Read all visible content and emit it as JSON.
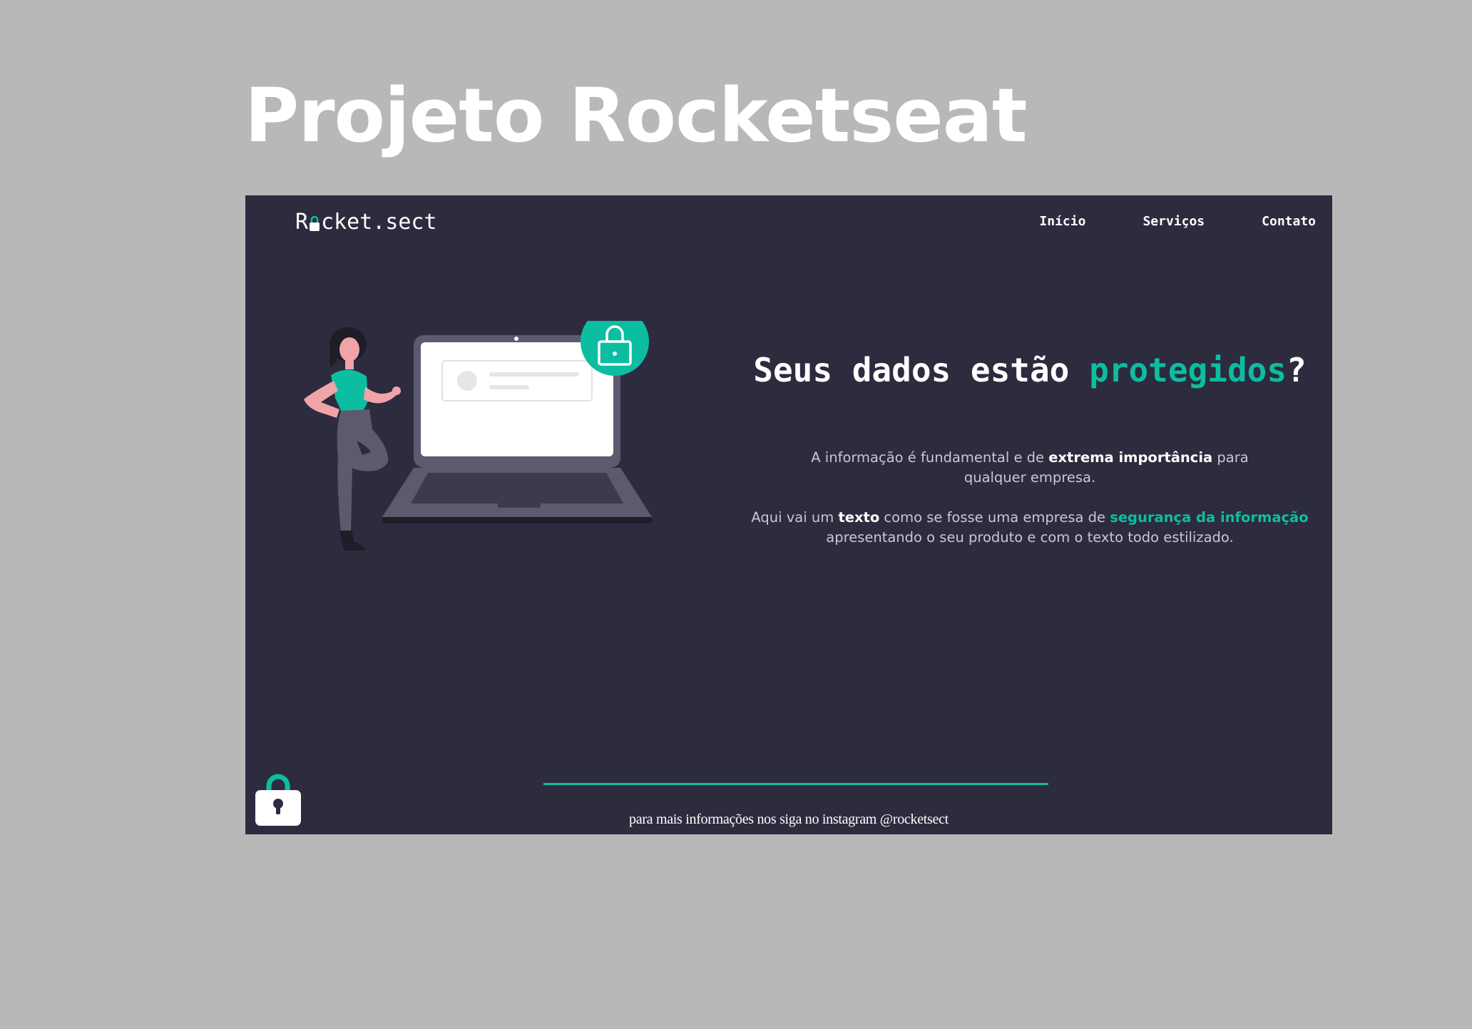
{
  "page": {
    "title": "Projeto Rocketseat"
  },
  "header": {
    "logo_prefix": "R",
    "logo_suffix": "cket.sect",
    "nav": [
      "Início",
      "Serviços",
      "Contato"
    ]
  },
  "hero": {
    "headline_main": "Seus dados estão ",
    "headline_accent": "protegidos",
    "headline_end": "?",
    "p1_a": "A informação é fundamental e de ",
    "p1_b": "extrema importância",
    "p1_c": " para qualquer empresa.",
    "p2_a": "Aqui vai um ",
    "p2_b": "texto",
    "p2_c": " como se fosse uma empresa de ",
    "p2_d": "segurança da informação",
    "p2_e": " apresentando o seu produto e com o texto todo estilizado."
  },
  "footer": {
    "text": "para mais informações nos siga no instagram @rocketsect"
  },
  "colors": {
    "background": "#b8b8b8",
    "frame": "#2d2b3e",
    "accent": "#0cbea1",
    "text": "#ffffff"
  },
  "icons": [
    "lock-logo-icon",
    "padlock-icon",
    "lock-badge-icon"
  ]
}
